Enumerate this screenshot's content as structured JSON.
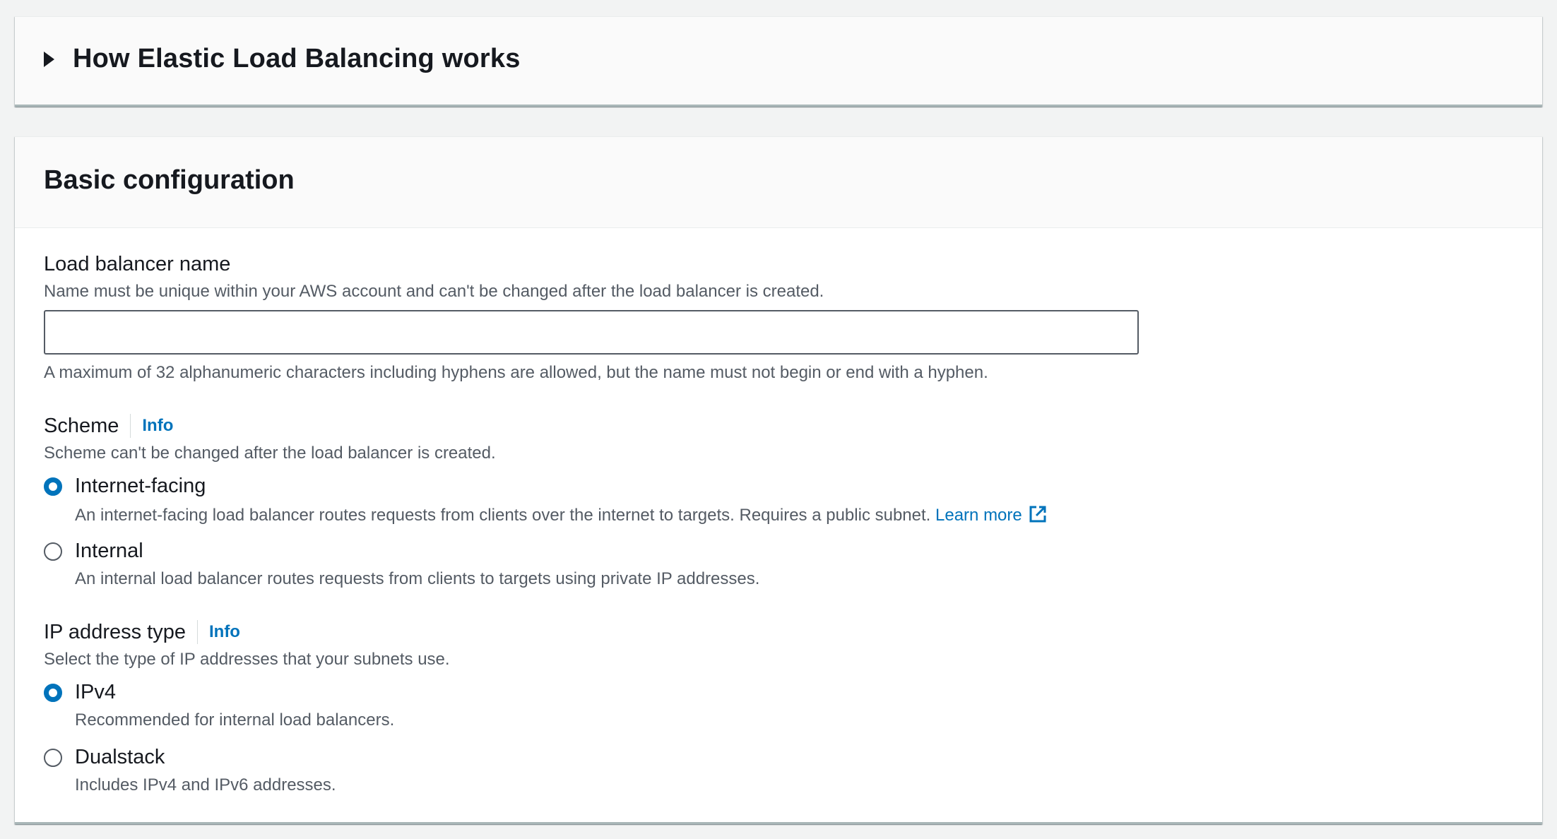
{
  "how_it_works": {
    "title": "How Elastic Load Balancing works"
  },
  "basic_config": {
    "title": "Basic configuration",
    "name_field": {
      "label": "Load balancer name",
      "description": "Name must be unique within your AWS account and can't be changed after the load balancer is created.",
      "value": "",
      "constraint": "A maximum of 32 alphanumeric characters including hyphens are allowed, but the name must not begin or end with a hyphen."
    },
    "scheme": {
      "label": "Scheme",
      "info": "Info",
      "description": "Scheme can't be changed after the load balancer is created.",
      "options": [
        {
          "label": "Internet-facing",
          "description": "An internet-facing load balancer routes requests from clients over the internet to targets. Requires a public subnet.",
          "link": "Learn more",
          "selected": true
        },
        {
          "label": "Internal",
          "description": "An internal load balancer routes requests from clients to targets using private IP addresses.",
          "selected": false
        }
      ]
    },
    "ip_type": {
      "label": "IP address type",
      "info": "Info",
      "description": "Select the type of IP addresses that your subnets use.",
      "options": [
        {
          "label": "IPv4",
          "description": "Recommended for internal load balancers.",
          "selected": true
        },
        {
          "label": "Dualstack",
          "description": "Includes IPv4 and IPv6 addresses.",
          "selected": false
        }
      ]
    }
  },
  "colors": {
    "link": "#0073bb",
    "text": "#16191f",
    "secondary_text": "#545b64",
    "background": "#f2f3f3"
  },
  "icons": {
    "expander": "caret-right-icon",
    "external": "external-link-icon"
  }
}
